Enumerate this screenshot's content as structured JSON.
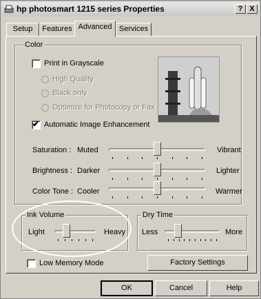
{
  "window": {
    "title": "hp photosmart 1215 series Properties",
    "help_glyph": "?",
    "close_glyph": "X"
  },
  "tabs": [
    {
      "label": "Setup"
    },
    {
      "label": "Features"
    },
    {
      "label": "Advanced",
      "active": true
    },
    {
      "label": "Services"
    }
  ],
  "color_group": {
    "title": "Color",
    "print_grayscale": {
      "label": "Print in Grayscale",
      "checked": false
    },
    "quality_options": [
      {
        "label": "High Quality",
        "enabled": false
      },
      {
        "label": "Black only",
        "enabled": false
      },
      {
        "label": "Optimize for Photocopy or Fax",
        "enabled": false
      }
    ],
    "auto_enhance": {
      "label": "Automatic Image Enhancement",
      "checked": true,
      "mark": "✔"
    },
    "sliders": [
      {
        "label": "Saturation :",
        "left": "Muted",
        "right": "Vibrant",
        "level": 0.5
      },
      {
        "label": "Brightness :",
        "left": "Darker",
        "right": "Lighter",
        "level": 0.5
      },
      {
        "label": "Color Tone :",
        "left": "Cooler",
        "right": "Warmer",
        "level": 0.5
      }
    ]
  },
  "ink_volume": {
    "title": "Ink Volume",
    "left": "Light",
    "right": "Heavy",
    "level": 0.25
  },
  "dry_time": {
    "title": "Dry Time",
    "left": "Less",
    "right": "More",
    "level": 0.2
  },
  "low_memory": {
    "label": "Low Memory Mode",
    "checked": false
  },
  "buttons": {
    "factory": "Factory Settings",
    "ok": "OK",
    "cancel": "Cancel",
    "help": "Help"
  },
  "colors": {
    "face": "#d4d0c8",
    "highlight_ring": "#ffffff"
  }
}
